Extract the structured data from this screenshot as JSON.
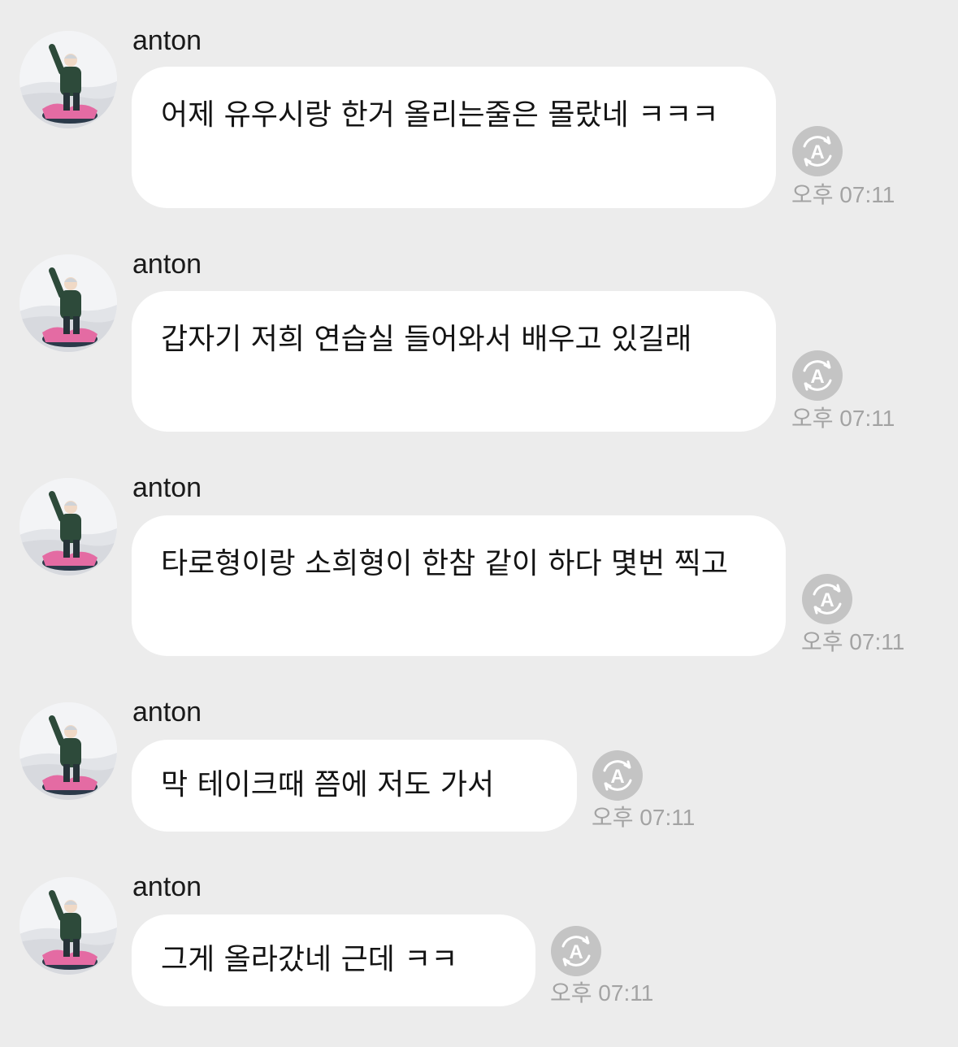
{
  "conversation": {
    "messages": [
      {
        "sender": "anton",
        "text": "어제 유우시랑 한거 올리는줄은 몰랐네 ㅋㅋㅋ",
        "translate_icon_letter": "A",
        "time": "오후 07:11"
      },
      {
        "sender": "anton",
        "text": "갑자기 저희 연습실 들어와서 배우고 있길래",
        "translate_icon_letter": "A",
        "time": "오후 07:11"
      },
      {
        "sender": "anton",
        "text": "타로형이랑 소희형이 한참 같이 하다 몇번 찍고",
        "translate_icon_letter": "A",
        "time": "오후 07:11"
      },
      {
        "sender": "anton",
        "text": "막 테이크때 쯤에 저도 가서",
        "translate_icon_letter": "A",
        "time": "오후 07:11"
      },
      {
        "sender": "anton",
        "text": "그게 올라갔네 근데 ㅋㅋ",
        "translate_icon_letter": "A",
        "time": "오후 07:11"
      }
    ]
  },
  "colors": {
    "background": "#ececec",
    "bubble": "#ffffff",
    "text": "#141414",
    "timestamp": "#a3a3a3",
    "icon": "#c4c4c4"
  }
}
